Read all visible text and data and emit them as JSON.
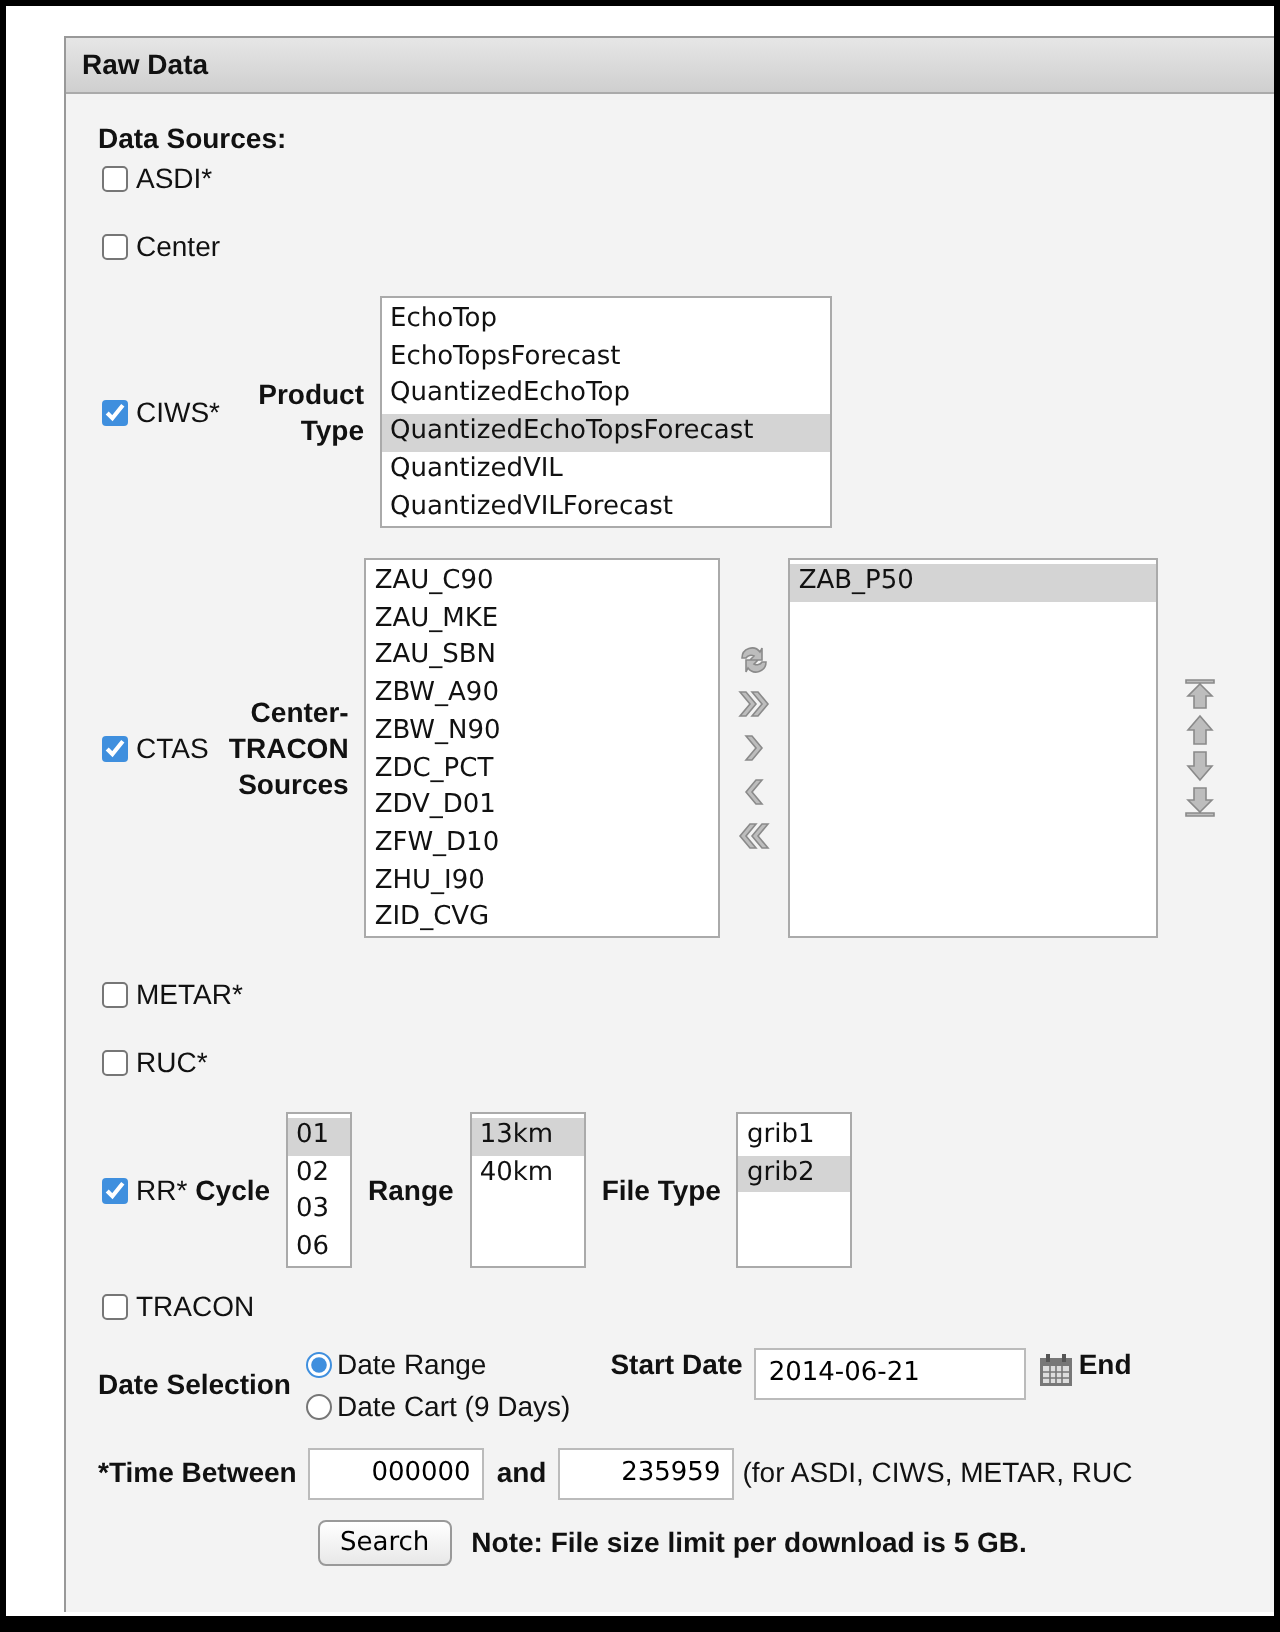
{
  "panel": {
    "title": "Raw Data"
  },
  "data_sources": {
    "label": "Data Sources:",
    "items": [
      {
        "kind": "plain",
        "label": "ASDI*",
        "checked": false
      },
      {
        "kind": "plain",
        "label": "Center",
        "checked": false
      },
      {
        "kind": "product",
        "label": "CIWS*",
        "checked": true,
        "field_label": "Product Type",
        "options": [
          {
            "text": "EchoTop",
            "selected": false
          },
          {
            "text": "EchoTopsForecast",
            "selected": false
          },
          {
            "text": "QuantizedEchoTop",
            "selected": false
          },
          {
            "text": "QuantizedEchoTopsForecast",
            "selected": true
          },
          {
            "text": "QuantizedVIL",
            "selected": false
          },
          {
            "text": "QuantizedVILForecast",
            "selected": false
          }
        ]
      },
      {
        "kind": "dual",
        "label": "CTAS",
        "checked": true,
        "field_label": "Center-TRACON Sources",
        "available": [
          {
            "text": "ZAU_C90",
            "selected": false
          },
          {
            "text": "ZAU_MKE",
            "selected": false
          },
          {
            "text": "ZAU_SBN",
            "selected": false
          },
          {
            "text": "ZBW_A90",
            "selected": false
          },
          {
            "text": "ZBW_N90",
            "selected": false
          },
          {
            "text": "ZDC_PCT",
            "selected": false
          },
          {
            "text": "ZDV_D01",
            "selected": false
          },
          {
            "text": "ZFW_D10",
            "selected": false
          },
          {
            "text": "ZHU_I90",
            "selected": false
          },
          {
            "text": "ZID_CVG",
            "selected": false
          }
        ],
        "chosen": [
          {
            "text": "ZAB_P50",
            "selected": true
          }
        ]
      },
      {
        "kind": "plain",
        "label": "METAR*",
        "checked": false
      },
      {
        "kind": "plain",
        "label": "RUC*",
        "checked": false
      },
      {
        "kind": "multi",
        "label": "RR*",
        "checked": true,
        "fields": [
          {
            "label": "Cycle",
            "options": [
              {
                "text": "01",
                "selected": true
              },
              {
                "text": "02",
                "selected": false
              },
              {
                "text": "03",
                "selected": false
              },
              {
                "text": "06",
                "selected": false
              }
            ]
          },
          {
            "label": "Range",
            "options": [
              {
                "text": "13km",
                "selected": true
              },
              {
                "text": "40km",
                "selected": false
              }
            ]
          },
          {
            "label": "File Type",
            "options": [
              {
                "text": "grib1",
                "selected": false
              },
              {
                "text": "grib2",
                "selected": true
              }
            ]
          }
        ]
      },
      {
        "kind": "plain",
        "label": "TRACON",
        "checked": false
      }
    ]
  },
  "date_selection": {
    "label": "Date Selection",
    "options": [
      {
        "label": "Date Range",
        "selected": true
      },
      {
        "label": "Date Cart (9 Days)",
        "selected": false
      }
    ],
    "start_label": "Start Date",
    "start_value": "2014-06-21",
    "end_label": "End"
  },
  "time": {
    "label": "*Time Between",
    "from": "000000",
    "joiner": "and",
    "to": "235959",
    "note": "(for ASDI, CIWS, METAR, RUC"
  },
  "search_button": "Search",
  "note": "Note: File size limit per download is 5 GB."
}
